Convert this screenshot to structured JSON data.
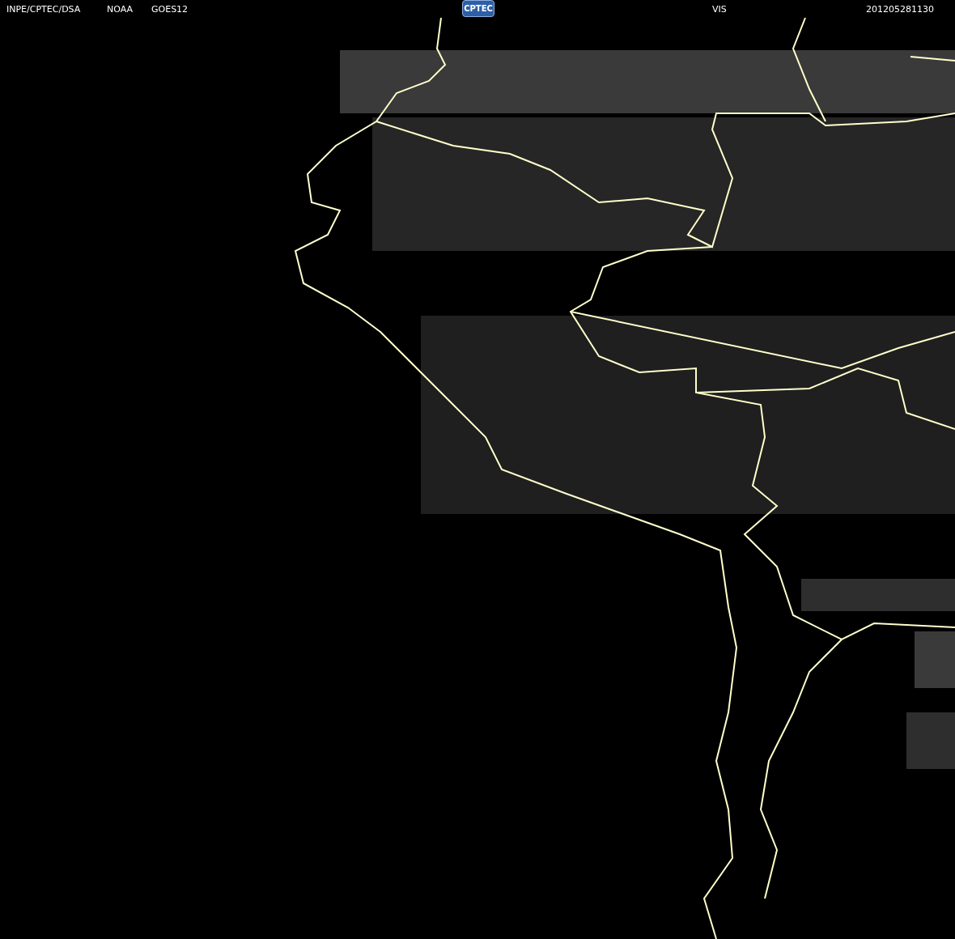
{
  "header": {
    "source": "INPE/CPTEC/DSA",
    "agency": "NOAA",
    "satellite": "GOES12",
    "logo": "CPTEC",
    "channel": "VIS",
    "timestamp": "201205281130"
  }
}
